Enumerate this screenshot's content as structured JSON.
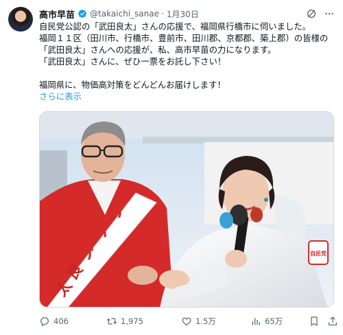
{
  "tweet": {
    "author_name": "高市早苗",
    "handle": "@takaichi_sanae",
    "separator": "·",
    "time": "1月30日",
    "lines": [
      "自民党公認の「武田良太」さんの応援で、福岡県行橋市に伺いました。",
      "福岡１１区（田川市、行橋市、豊前市、田川郡、京都郡、築上郡）の皆様の",
      "「武田良太」さんへの応援が、私、高市早苗の力になります。",
      "「武田良太」さんに、ぜひ一票をお託し下さい！",
      "",
      "福岡県に、物価高対策をどんどんお届けします！"
    ],
    "show_more": "さらに表示"
  },
  "photo": {
    "sash_text": "武田良太",
    "sash_glyphs": [
      "タ",
      "ケ",
      "ダ",
      "良",
      "太"
    ],
    "badge_text": "自民党"
  },
  "actions": {
    "replies": "406",
    "retweets": "1,975",
    "likes": "1.5万",
    "views": "65万"
  },
  "colors": {
    "accent": "#1d9bf0",
    "verified": "#1d9bf0",
    "muted": "#536471"
  },
  "icons": [
    "verified-badge-icon",
    "grok-icon",
    "more-icon",
    "reply-icon",
    "retweet-icon",
    "like-icon",
    "views-icon",
    "bookmark-icon",
    "share-icon"
  ]
}
